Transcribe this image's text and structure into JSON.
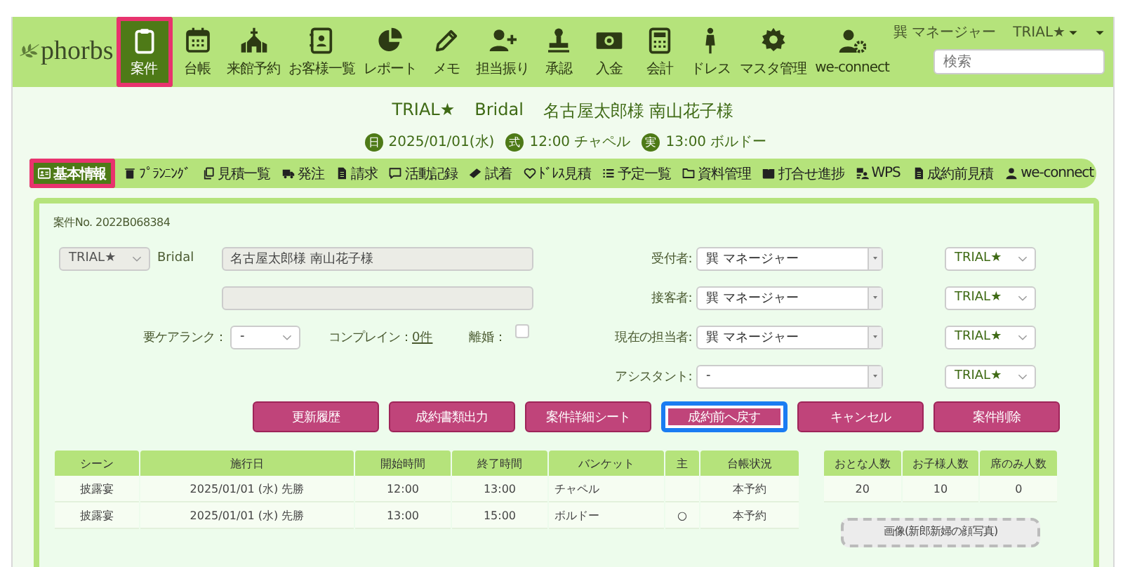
{
  "logo": {
    "text": "phorbs"
  },
  "nav": [
    {
      "label": "案件",
      "selected": true,
      "highlighted": true
    },
    {
      "label": "台帳",
      "selected": false,
      "highlighted": false
    },
    {
      "label": "来館予約",
      "selected": false,
      "highlighted": false
    },
    {
      "label": "お客様一覧",
      "selected": false,
      "highlighted": false
    },
    {
      "label": "レポート",
      "selected": false,
      "highlighted": false
    },
    {
      "label": "メモ",
      "selected": false,
      "highlighted": false
    },
    {
      "label": "担当振り",
      "selected": false,
      "highlighted": false
    },
    {
      "label": "承認",
      "selected": false,
      "highlighted": false
    },
    {
      "label": "入金",
      "selected": false,
      "highlighted": false
    },
    {
      "label": "会計",
      "selected": false,
      "highlighted": false
    },
    {
      "label": "ドレス",
      "selected": false,
      "highlighted": false
    },
    {
      "label": "マスタ管理",
      "selected": false,
      "highlighted": false
    },
    {
      "label": "we-connect",
      "selected": false,
      "highlighted": false
    }
  ],
  "user": {
    "name": "巽 マネージャー",
    "company": "TRIAL★"
  },
  "search": {
    "placeholder": "検索"
  },
  "title": {
    "venue": "TRIAL★",
    "type": "Bridal",
    "couple": "名古屋太郎様 南山花子様"
  },
  "info": [
    {
      "badge": "日",
      "text": "2025/01/01(水)"
    },
    {
      "badge": "式",
      "text": "12:00 チャペル"
    },
    {
      "badge": "実",
      "text": "13:00 ボルドー"
    }
  ],
  "tabs": [
    {
      "label": "基本情報",
      "selected": true,
      "highlighted": true
    },
    {
      "label": "ﾌﾟﾗﾝﾆﾝｸﾞ",
      "selected": false,
      "highlighted": false
    },
    {
      "label": "見積一覧",
      "selected": false,
      "highlighted": false
    },
    {
      "label": "発注",
      "selected": false,
      "highlighted": false
    },
    {
      "label": "請求",
      "selected": false,
      "highlighted": false
    },
    {
      "label": "活動記録",
      "selected": false,
      "highlighted": false
    },
    {
      "label": "試着",
      "selected": false,
      "highlighted": false
    },
    {
      "label": "ﾄﾞﾚｽ見積",
      "selected": false,
      "highlighted": false
    },
    {
      "label": "予定一覧",
      "selected": false,
      "highlighted": false
    },
    {
      "label": "資料管理",
      "selected": false,
      "highlighted": false
    },
    {
      "label": "打合せ進捗",
      "selected": false,
      "highlighted": false
    },
    {
      "label": "WPS",
      "selected": false,
      "highlighted": false
    },
    {
      "label": "成約前見積",
      "selected": false,
      "highlighted": false
    },
    {
      "label": "we-connect",
      "selected": false,
      "highlighted": false
    }
  ],
  "case_no": "案件No. 2022B068384",
  "venue_select": {
    "value": "TRIAL★",
    "disabled": true
  },
  "type_label": "Bridal",
  "name_fields": [
    {
      "value": "名古屋太郎様 南山花子様",
      "disabled": true
    },
    {
      "disabled": true
    }
  ],
  "care_rank": {
    "label": "要ケアランク：",
    "value": "-"
  },
  "complaint": {
    "label": "コンプレイン：",
    "link": "0件"
  },
  "divorce": {
    "label": "離婚：",
    "checked": false
  },
  "staff": [
    {
      "label": "受付者:",
      "value": "巽 マネージャー",
      "venue": "TRIAL★"
    },
    {
      "label": "接客者:",
      "value": "巽 マネージャー",
      "venue": "TRIAL★"
    },
    {
      "label": "現在の担当者:",
      "value": "巽 マネージャー",
      "venue": "TRIAL★"
    },
    {
      "label": "アシスタント:",
      "value": "-",
      "venue": "TRIAL★"
    }
  ],
  "buttons": [
    {
      "label": "更新履歴",
      "highlighted": false
    },
    {
      "label": "成約書類出力",
      "highlighted": false
    },
    {
      "label": "案件詳細シート",
      "highlighted": false
    },
    {
      "label": "成約前へ戻す",
      "highlighted": true
    },
    {
      "label": "キャンセル",
      "highlighted": false
    },
    {
      "label": "案件削除",
      "highlighted": false
    }
  ],
  "schedule": {
    "columns": [
      "シーン",
      "施行日",
      "開始時間",
      "終了時間",
      "バンケット",
      "主",
      "台帳状況"
    ],
    "rows": [
      {
        "scene": "披露宴",
        "date": "2025/01/01 (水) 先勝",
        "start": "12:00",
        "end": "13:00",
        "banquet": "チャペル",
        "status": "本予約"
      },
      {
        "scene": "披露宴",
        "date": "2025/01/01 (水) 先勝",
        "start": "13:00",
        "end": "15:00",
        "banquet": "ボルドー",
        "main": "○",
        "status": "本予約"
      }
    ]
  },
  "guests": {
    "columns": [
      "おとな人数",
      "お子様人数",
      "席のみ人数"
    ],
    "values": [
      "20",
      "10",
      "0"
    ]
  },
  "photo_label": "画像(新郎新婦の顔写真)"
}
